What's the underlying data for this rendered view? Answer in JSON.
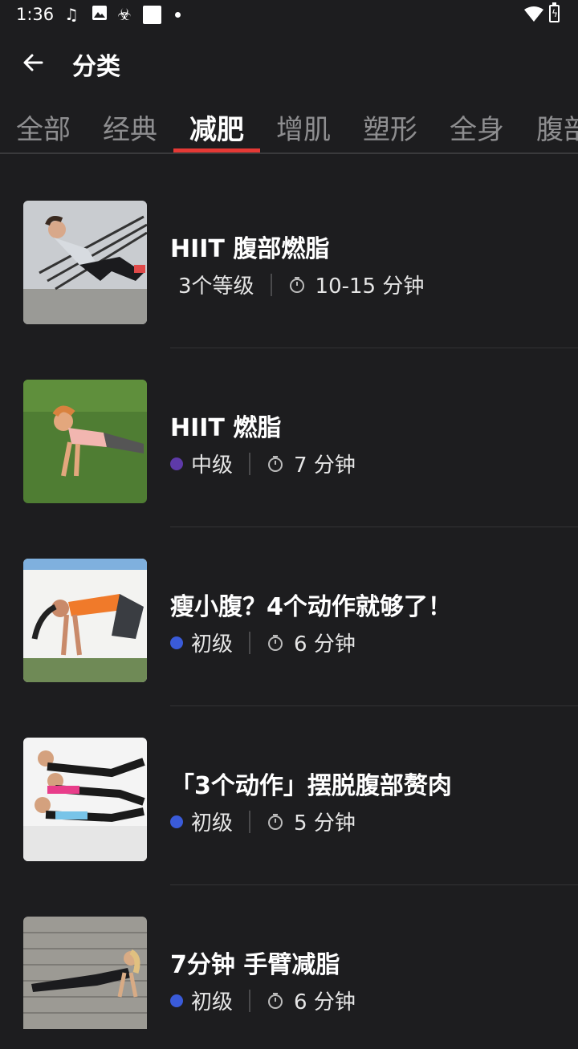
{
  "status": {
    "time": "1:36"
  },
  "toolbar": {
    "title": "分类"
  },
  "tabs": [
    "全部",
    "经典",
    "减肥",
    "增肌",
    "塑形",
    "全身",
    "腹部"
  ],
  "active_tab_index": 2,
  "colors": {
    "background": "#1d1d1f",
    "tab_indicator": "#e53935",
    "intermediate_dot": "#5e3aa8",
    "beginner_dot": "#3a5bd9"
  },
  "items": [
    {
      "title": "HIIT 腹部燃脂",
      "level": "3个等级",
      "level_color": "",
      "duration": "10-15 分钟"
    },
    {
      "title": "HIIT 燃脂",
      "level": "中级",
      "level_color": "#5e3aa8",
      "duration": "7 分钟"
    },
    {
      "title": "瘦小腹？4个动作就够了！",
      "level": "初级",
      "level_color": "#3a5bd9",
      "duration": "6 分钟"
    },
    {
      "title": "「3个动作」摆脱腹部赘肉",
      "level": "初级",
      "level_color": "#3a5bd9",
      "duration": "5 分钟"
    },
    {
      "title": "7分钟 手臂减脂",
      "level": "初级",
      "level_color": "#3a5bd9",
      "duration": "6 分钟"
    }
  ]
}
